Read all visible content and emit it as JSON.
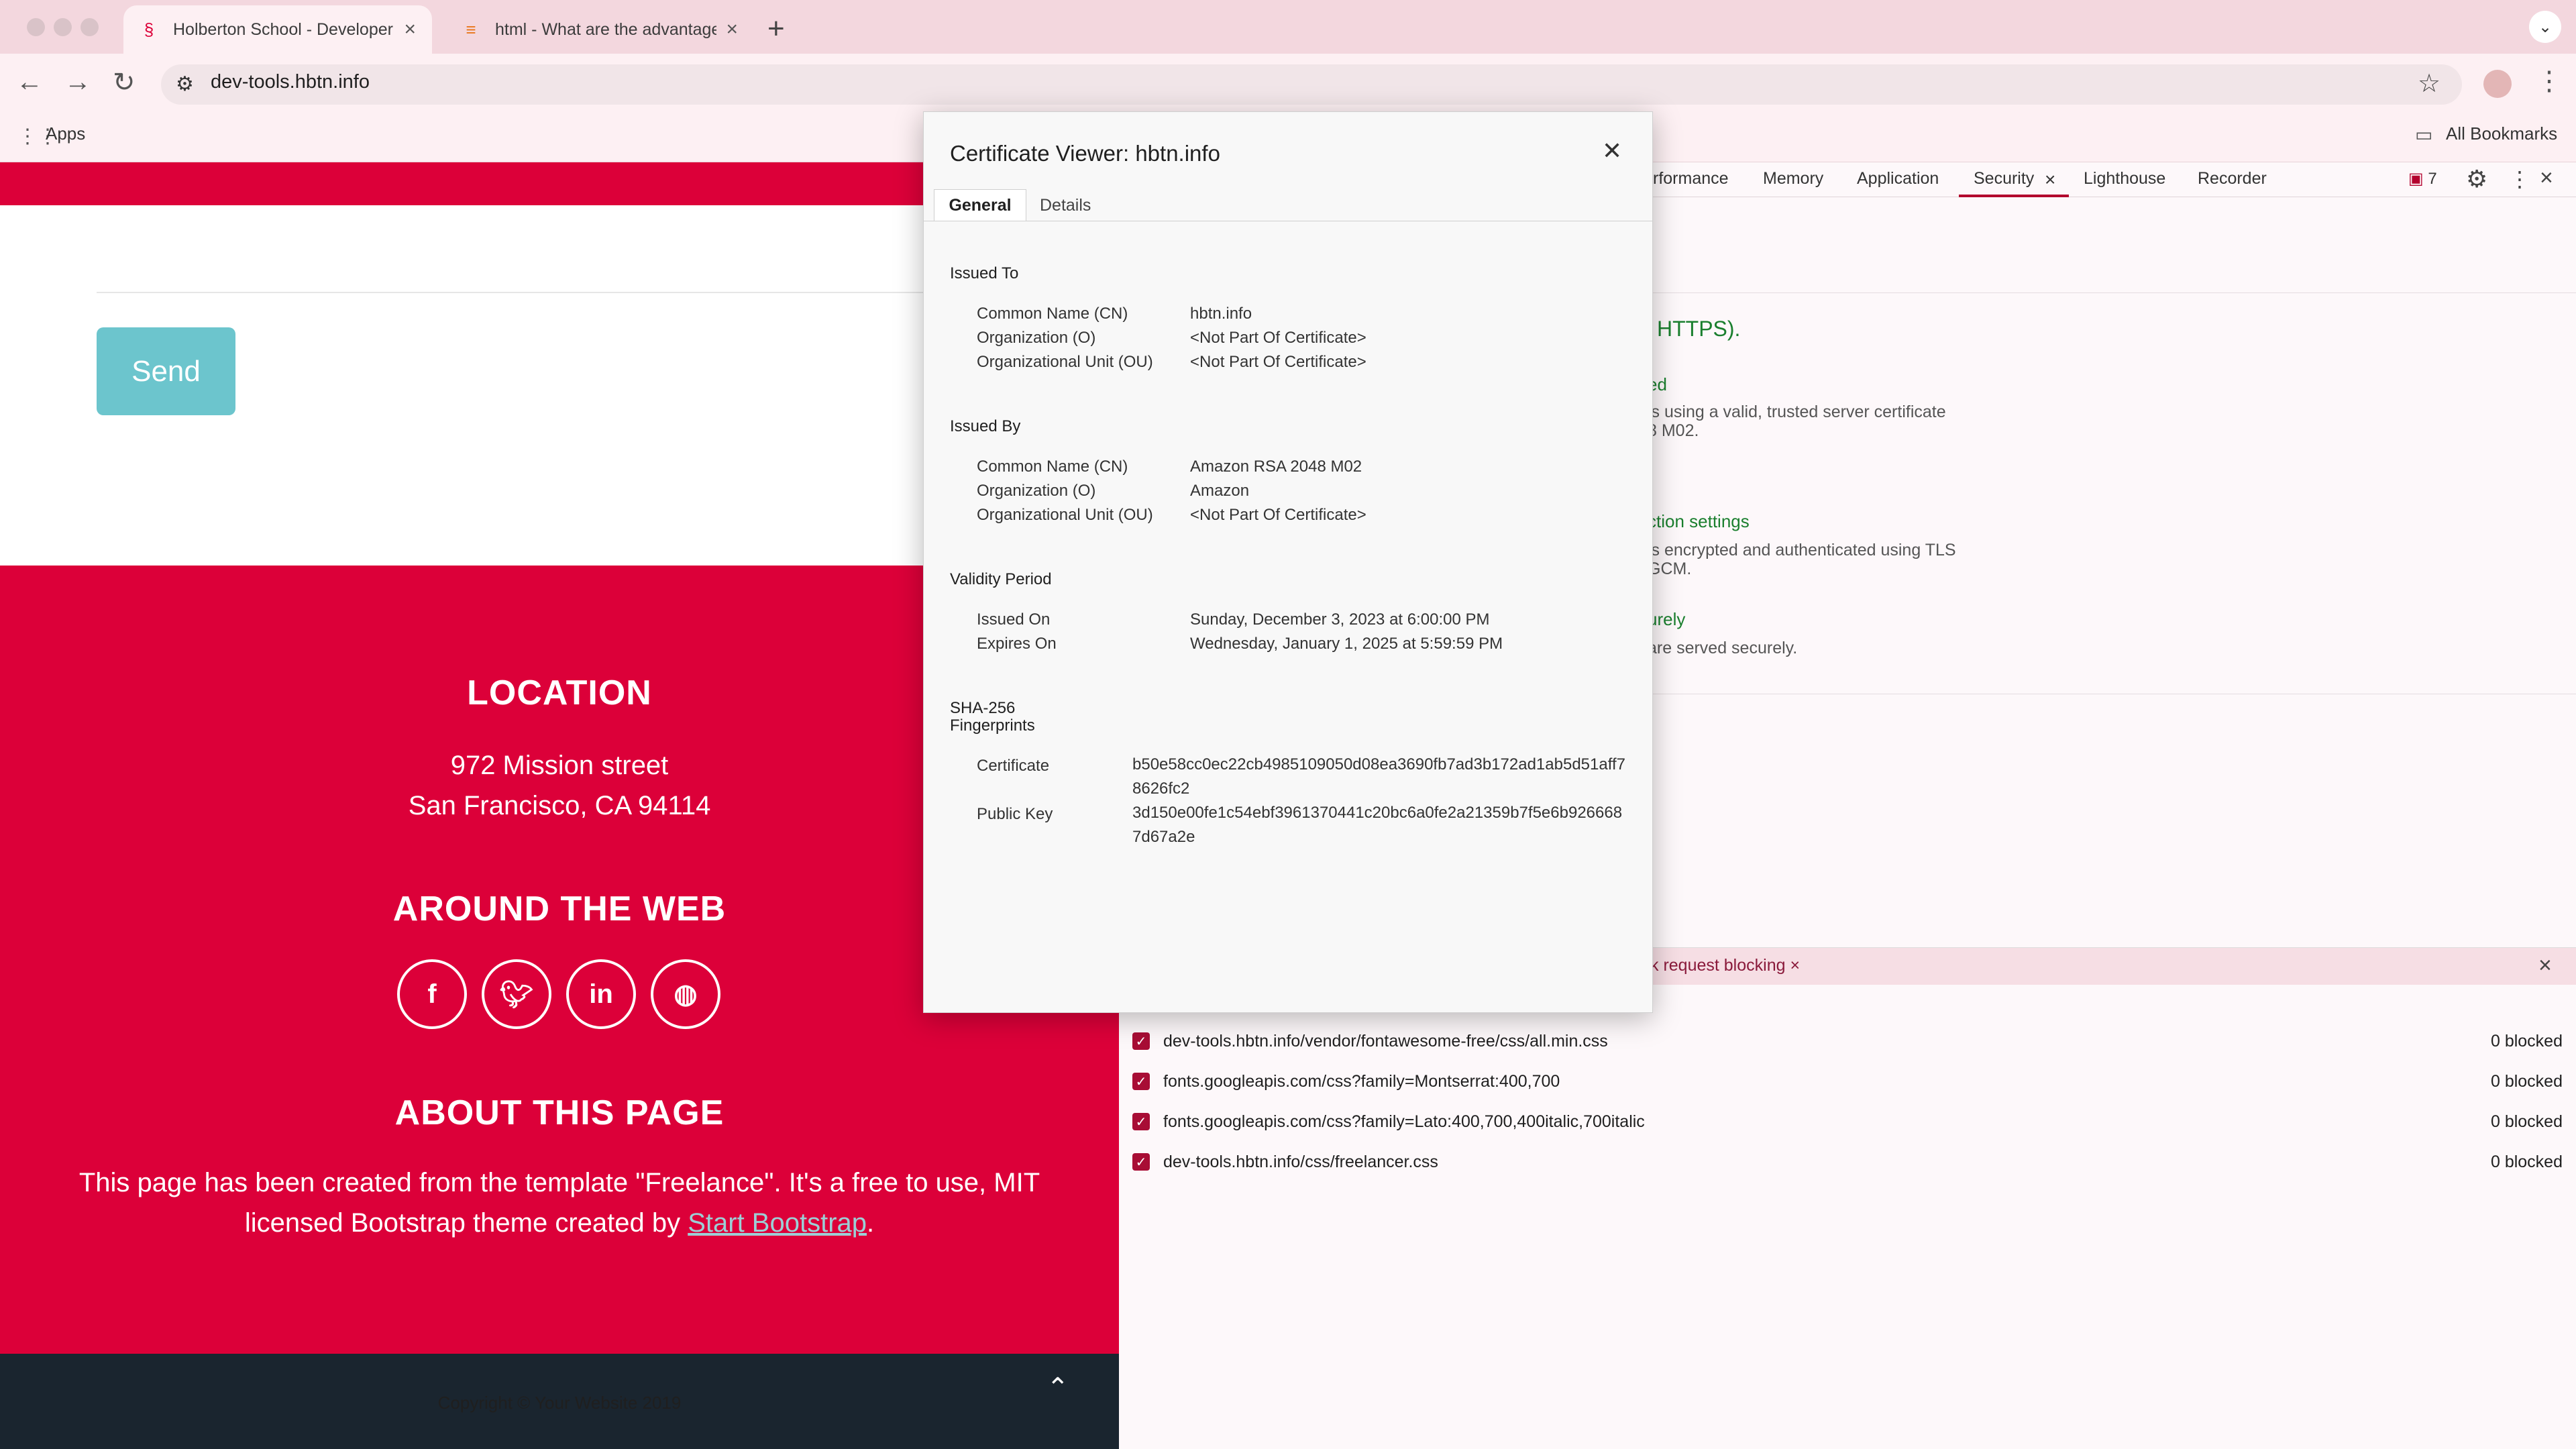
{
  "browser": {
    "tabs": [
      {
        "title": "Holberton School - Developer Tools",
        "active": true
      },
      {
        "title": "html - What are the advantages",
        "active": false
      }
    ],
    "address": "dev-tools.hbtn.info",
    "bookmarks": {
      "apps": "Apps",
      "all": "All Bookmarks"
    }
  },
  "page": {
    "send_label": "Send",
    "location_title": "LOCATION",
    "address_line1": "972 Mission street",
    "address_line2": "San Francisco, CA 94114",
    "web_title": "AROUND THE WEB",
    "social": [
      "f",
      "t",
      "in",
      "dribbble"
    ],
    "about_title": "ABOUT THIS PAGE",
    "about_line1": "This page has been created from the template \"Freelance\". It's a free to use, MIT",
    "about_line2_pre": "licensed Bootstrap theme created by ",
    "about_link": "Start Bootstrap",
    "about_line2_post": ".",
    "copyright": "Copyright © Your Website 2019"
  },
  "devtools": {
    "tabs": [
      "rformance",
      "Memory",
      "Application",
      "Security",
      "Lighthouse",
      "Recorder"
    ],
    "issues_count": "7",
    "security": {
      "https": "HTTPS).",
      "cert_heading": "ed",
      "cert_line1": "is using a valid, trusted server certificate",
      "cert_line2": "8 M02.",
      "conn_heading": "ction settings",
      "conn_line1": "is encrypted and authenticated using TLS",
      "conn_line2": "GCM.",
      "res_heading": "urely",
      "res_line1": "are served securely."
    },
    "drawer_tab": "k request blocking",
    "blocked": [
      {
        "url": "dev-tools.hbtn.info/vendor/fontawesome-free/css/all.min.css",
        "count": "0 blocked"
      },
      {
        "url": "fonts.googleapis.com/css?family=Montserrat:400,700",
        "count": "0 blocked"
      },
      {
        "url": "fonts.googleapis.com/css?family=Lato:400,700,400italic,700italic",
        "count": "0 blocked"
      },
      {
        "url": "dev-tools.hbtn.info/css/freelancer.css",
        "count": "0 blocked"
      }
    ]
  },
  "certificate": {
    "title": "Certificate Viewer: hbtn.info",
    "tab_general": "General",
    "tab_details": "Details",
    "issued_to": {
      "heading": "Issued To",
      "cn_label": "Common Name (CN)",
      "cn": "hbtn.info",
      "o_label": "Organization (O)",
      "o": "<Not Part Of Certificate>",
      "ou_label": "Organizational Unit (OU)",
      "ou": "<Not Part Of Certificate>"
    },
    "issued_by": {
      "heading": "Issued By",
      "cn_label": "Common Name (CN)",
      "cn": "Amazon RSA 2048 M02",
      "o_label": "Organization (O)",
      "o": "Amazon",
      "ou_label": "Organizational Unit (OU)",
      "ou": "<Not Part Of Certificate>"
    },
    "validity": {
      "heading": "Validity Period",
      "on_label": "Issued On",
      "on": "Sunday, December 3, 2023 at 6:00:00 PM",
      "exp_label": "Expires On",
      "exp": "Wednesday, January 1, 2025 at 5:59:59 PM"
    },
    "fingerprints": {
      "heading1": "SHA-256",
      "heading2": "Fingerprints",
      "cert_label": "Certificate",
      "cert": "b50e58cc0ec22cb4985109050d08ea3690fb7ad3b172ad1ab5d51aff78626fc2",
      "key_label": "Public Key",
      "key": "3d150e00fe1c54ebf3961370441c20bc6a0fe2a21359b7f5e6b9266687d67a2e"
    }
  }
}
